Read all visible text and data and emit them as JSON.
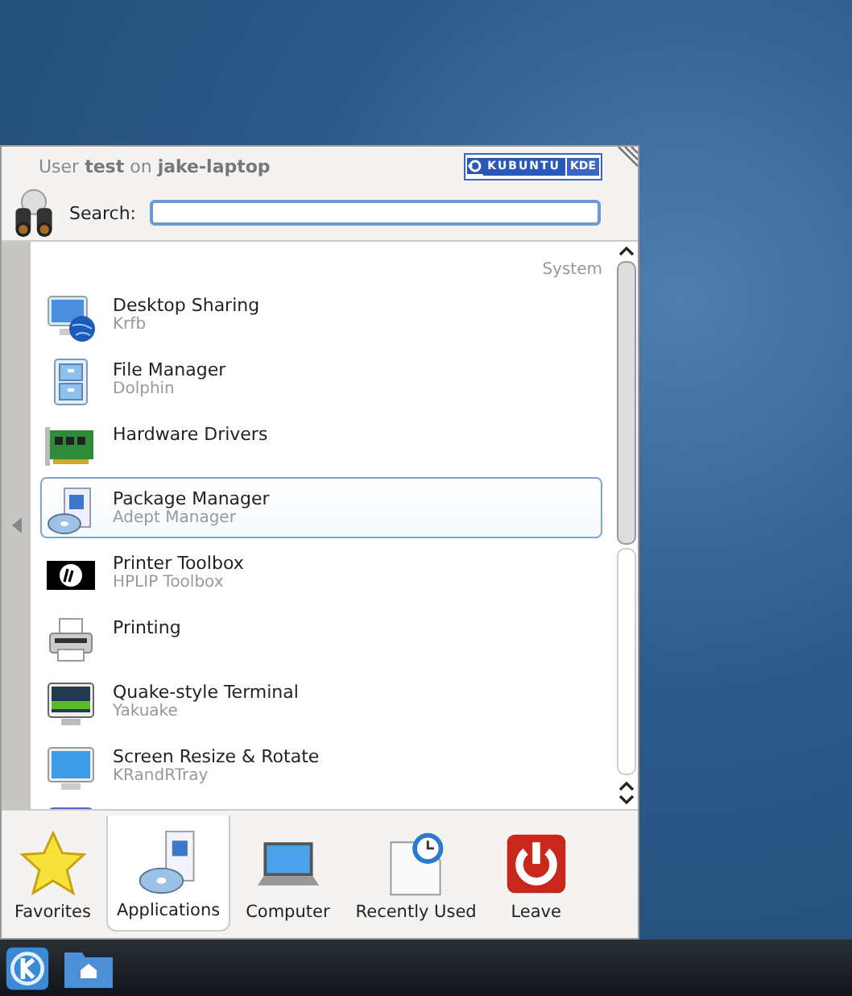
{
  "header": {
    "user_line": "User **test** on **jake-laptop**",
    "logo": [
      "KUBUNTU",
      "KDE"
    ]
  },
  "search": {
    "label": "Search:",
    "focused": true
  },
  "list": {
    "section": "System",
    "items": [
      {
        "name": "Desktop Sharing",
        "description": "Krfb",
        "kind": "sharing",
        "selected": false
      },
      {
        "name": "File Manager",
        "description": "Dolphin",
        "kind": "cabinet",
        "selected": false
      },
      {
        "name": "Hardware Drivers",
        "kind": "card",
        "selected": false
      },
      {
        "name": "Package Manager",
        "description": "Adept Manager",
        "kind": "package",
        "selected": true
      },
      {
        "name": "Printer Toolbox",
        "description": "HPLIP Toolbox",
        "kind": "hp",
        "selected": false
      },
      {
        "name": "Printing",
        "kind": "printer",
        "selected": false
      },
      {
        "name": "Quake-style Terminal",
        "description": "Yakuake",
        "kind": "terminal",
        "selected": false
      },
      {
        "name": "Screen Resize & Rotate",
        "description": "KRandRTray",
        "kind": "monitor",
        "selected": false
      }
    ]
  },
  "tabs": [
    {
      "label": "Favorites",
      "kind": "star",
      "selected": false
    },
    {
      "label": "Applications",
      "kind": "package",
      "selected": true
    },
    {
      "label": "Computer",
      "kind": "laptop",
      "selected": false
    },
    {
      "label": "Recently Used",
      "kind": "clock",
      "selected": false
    },
    {
      "label": "Leave",
      "kind": "power",
      "selected": false
    }
  ]
}
